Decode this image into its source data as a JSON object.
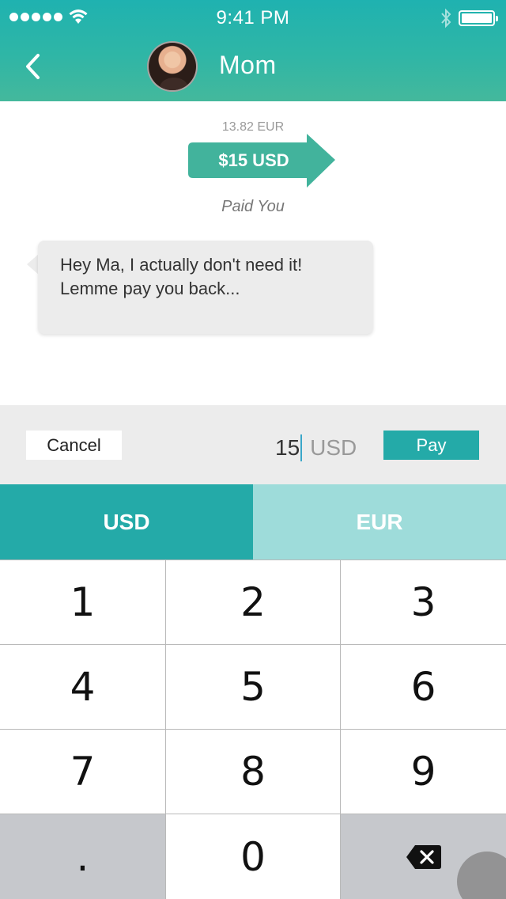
{
  "status": {
    "time": "9:41 PM"
  },
  "header": {
    "contact_name": "Mom"
  },
  "payment": {
    "converted_amount": "13.82 EUR",
    "amount_label": "$15 USD",
    "status_label": "Paid You"
  },
  "message": {
    "text": "Hey Ma, I actually don't need it! Lemme pay you back..."
  },
  "input_bar": {
    "cancel_label": "Cancel",
    "amount_value": "15",
    "amount_currency": "USD",
    "pay_label": "Pay"
  },
  "currency_toggle": {
    "options": [
      "USD",
      "EUR"
    ],
    "selected": "USD"
  },
  "keypad": {
    "keys": [
      "1",
      "2",
      "3",
      "4",
      "5",
      "6",
      "7",
      "8",
      "9",
      ".",
      "0"
    ],
    "delete_icon": "backspace-icon"
  },
  "colors": {
    "accent": "#24aaa8",
    "accent_light": "#9edcda"
  }
}
